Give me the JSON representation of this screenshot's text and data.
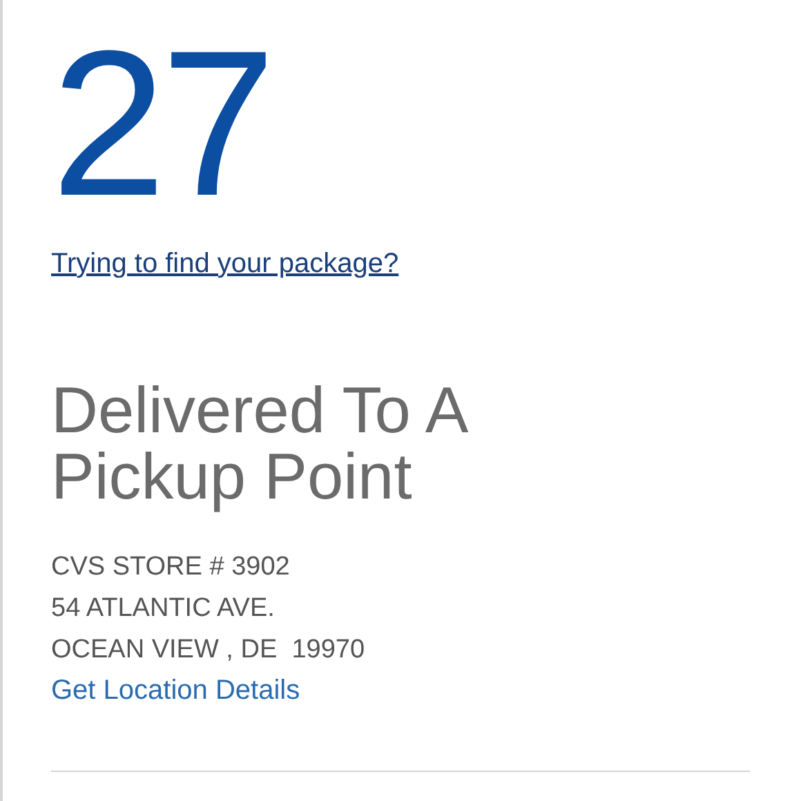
{
  "date_day": "27",
  "help_link": "Trying to find your package?",
  "status": "Delivered To A Pickup Point",
  "address_lines": [
    "CVS STORE # 3902",
    "54 ATLANTIC AVE.",
    "OCEAN VIEW , DE  19970"
  ],
  "details_link": "Get Location Details"
}
